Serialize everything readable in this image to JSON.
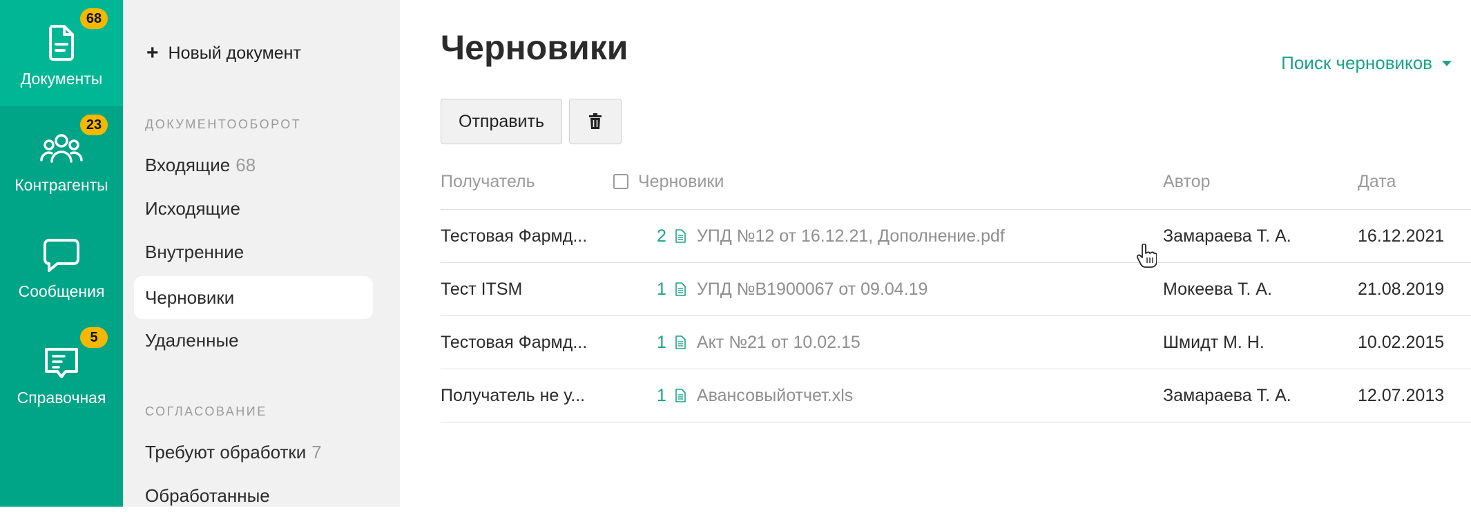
{
  "rail": {
    "items": [
      {
        "label": "Документы",
        "badge": "68",
        "icon": "document-icon",
        "active": true
      },
      {
        "label": "Контрагенты",
        "badge": "23",
        "icon": "people-icon",
        "active": false
      },
      {
        "label": "Сообщения",
        "badge": "",
        "icon": "chat-bubble-icon",
        "active": false
      },
      {
        "label": "Справочная",
        "badge": "5",
        "icon": "book-icon",
        "active": false
      }
    ],
    "accent": "#00a486",
    "badge_color": "#f5b800"
  },
  "subnav": {
    "new_document": "Новый документ",
    "section_docflow": "ДОКУМЕНТООБОРОТ",
    "section_approval": "СОГЛАСОВАНИЕ",
    "items": [
      {
        "label": "Входящие",
        "count": "68"
      },
      {
        "label": "Исходящие",
        "count": ""
      },
      {
        "label": "Внутренние",
        "count": ""
      },
      {
        "label": "Черновики",
        "count": "",
        "active": true
      },
      {
        "label": "Удаленные",
        "count": ""
      },
      {
        "label": "Требуют обработки",
        "count": "7"
      },
      {
        "label": "Обработанные",
        "count": ""
      }
    ]
  },
  "main": {
    "title": "Черновики",
    "search_label": "Поиск черновиков",
    "send_button": "Отправить",
    "delete_icon": "trash-icon",
    "columns": {
      "recipient": "Получатель",
      "drafts": "Черновики",
      "author": "Автор",
      "date": "Дата"
    },
    "rows": [
      {
        "recipient": "Тестовая Фармд...",
        "count": "2",
        "file": "УПД №12 от 16.12.21, Дополнение.pdf",
        "author": "Замараева Т. А.",
        "date": "16.12.2021"
      },
      {
        "recipient": "Тест ITSM",
        "count": "1",
        "file": "УПД №В1900067 от 09.04.19",
        "author": "Мокеева Т. А.",
        "date": "21.08.2019"
      },
      {
        "recipient": "Тестовая Фармд...",
        "count": "1",
        "file": "Акт №21 от 10.02.15",
        "author": "Шмидт М. Н.",
        "date": "10.02.2015"
      },
      {
        "recipient": "Получатель не у...",
        "count": "1",
        "file": "Авансовыйотчет.xls",
        "author": "Замараева Т. А.",
        "date": "12.07.2013"
      }
    ],
    "link_color": "#1aa38a"
  }
}
